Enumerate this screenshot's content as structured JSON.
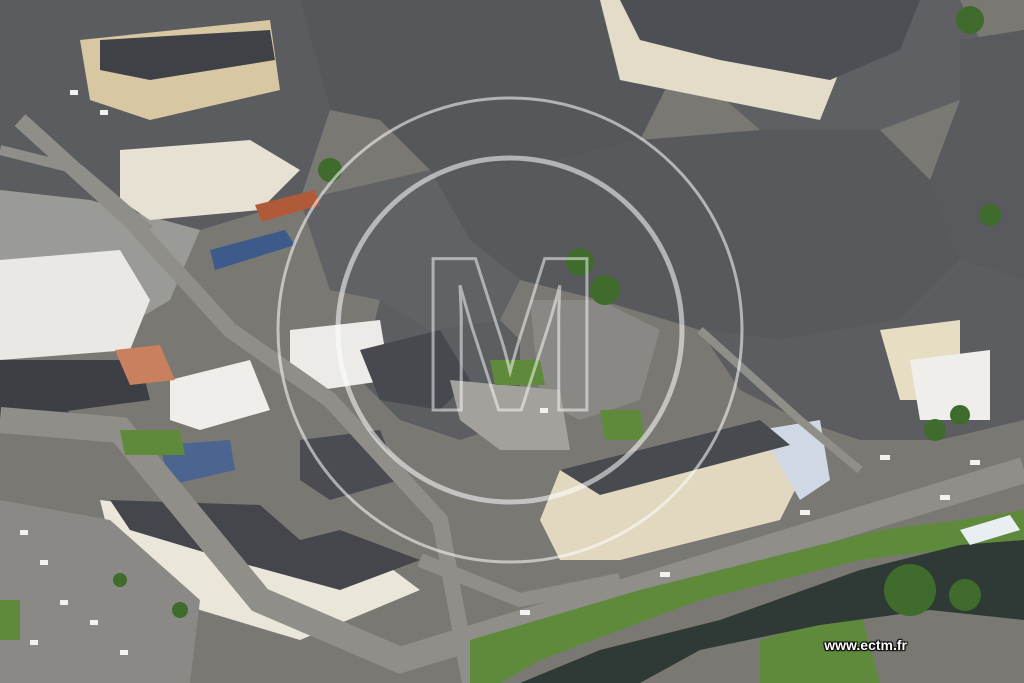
{
  "photo": {
    "watermark_url": "www.ectm.fr",
    "watermark_logo_letters": "M"
  },
  "palette": {
    "roof": "#4a4d52",
    "roof_dark": "#34363a",
    "facade": "#e6dfcf",
    "facade_warm": "#d9c9a6",
    "street": "#8d8c87",
    "plaza": "#a9a79f",
    "grass": "#5f8a3c",
    "water": "#2e3a35",
    "tree": "#3f6b2c",
    "solar": "#3d5a8a"
  }
}
